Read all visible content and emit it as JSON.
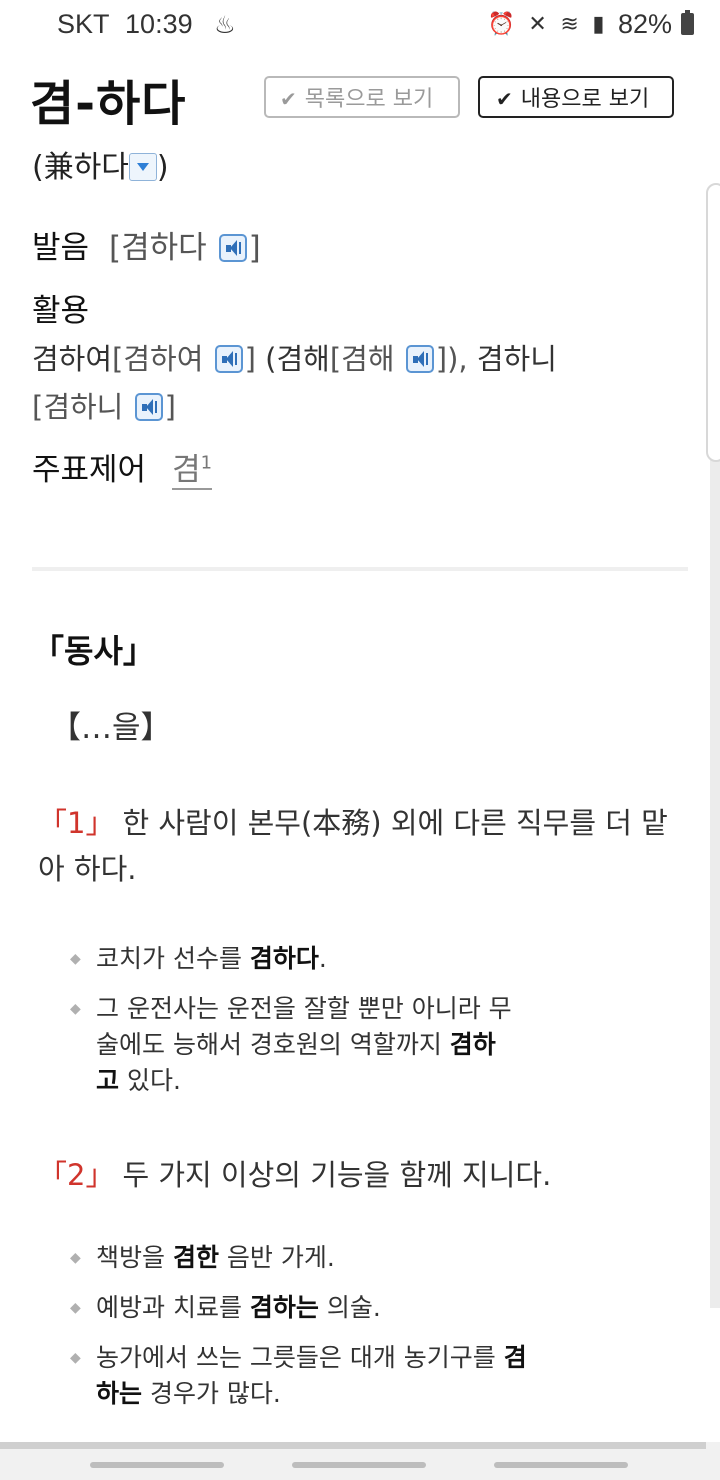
{
  "status": {
    "carrier": "SKT",
    "time": "10:39",
    "battery": "82%"
  },
  "entry": {
    "headword": "겸-하다",
    "hanja_prefix": "(兼하다",
    "hanja_suffix": ")",
    "view_list_label": "목록으로 보기",
    "view_content_label": "내용으로 보기",
    "pronunciation_label": "발음",
    "pronunciation": "[겸하다",
    "conjugation_label": "활용",
    "conj": [
      {
        "form": "겸하여",
        "pron": "[겸하여"
      },
      {
        "form": "(겸해",
        "pron": "[겸해"
      },
      {
        "form": "겸하니",
        "pron": "[겸하니"
      }
    ],
    "main_entry_label": "주표제어",
    "main_entry_word": "겸",
    "main_entry_sup": "1"
  },
  "senses": {
    "pos": "「동사」",
    "pattern": "【…을】",
    "items": [
      {
        "num": "「1」",
        "definition": "한 사람이 본무(本務) 외에 다른 직무를 더 맡아 하다.",
        "examples": [
          {
            "pre": "코치가 선수를 ",
            "bold": "겸하다",
            "post": "."
          },
          {
            "pre": "그 운전사는 운전을 잘할 뿐만 아니라 무술에도 능해서 경호원의 역할까지 ",
            "bold": "겸하고",
            "post": " 있다."
          }
        ]
      },
      {
        "num": "「2」",
        "definition": "두 가지 이상의 기능을 함께 지니다.",
        "examples": [
          {
            "pre": "책방을 ",
            "bold": "겸한",
            "post": " 음반 가게."
          },
          {
            "pre": "예방과 치료를 ",
            "bold": "겸하는",
            "post": " 의술."
          },
          {
            "pre": "농가에서 쓰는 그릇들은 대개 농기구를 ",
            "bold": "겸하는",
            "post": " 경우가 많다."
          }
        ]
      }
    ]
  },
  "icons": {
    "speaker": "speaker-icon",
    "dropdown": "dropdown-icon",
    "check": "check-icon",
    "alarm": "alarm-icon",
    "mute": "mute-icon",
    "wifi": "wifi-icon",
    "signal": "signal-icon",
    "battery": "battery-icon",
    "notification": "notification-icon"
  }
}
